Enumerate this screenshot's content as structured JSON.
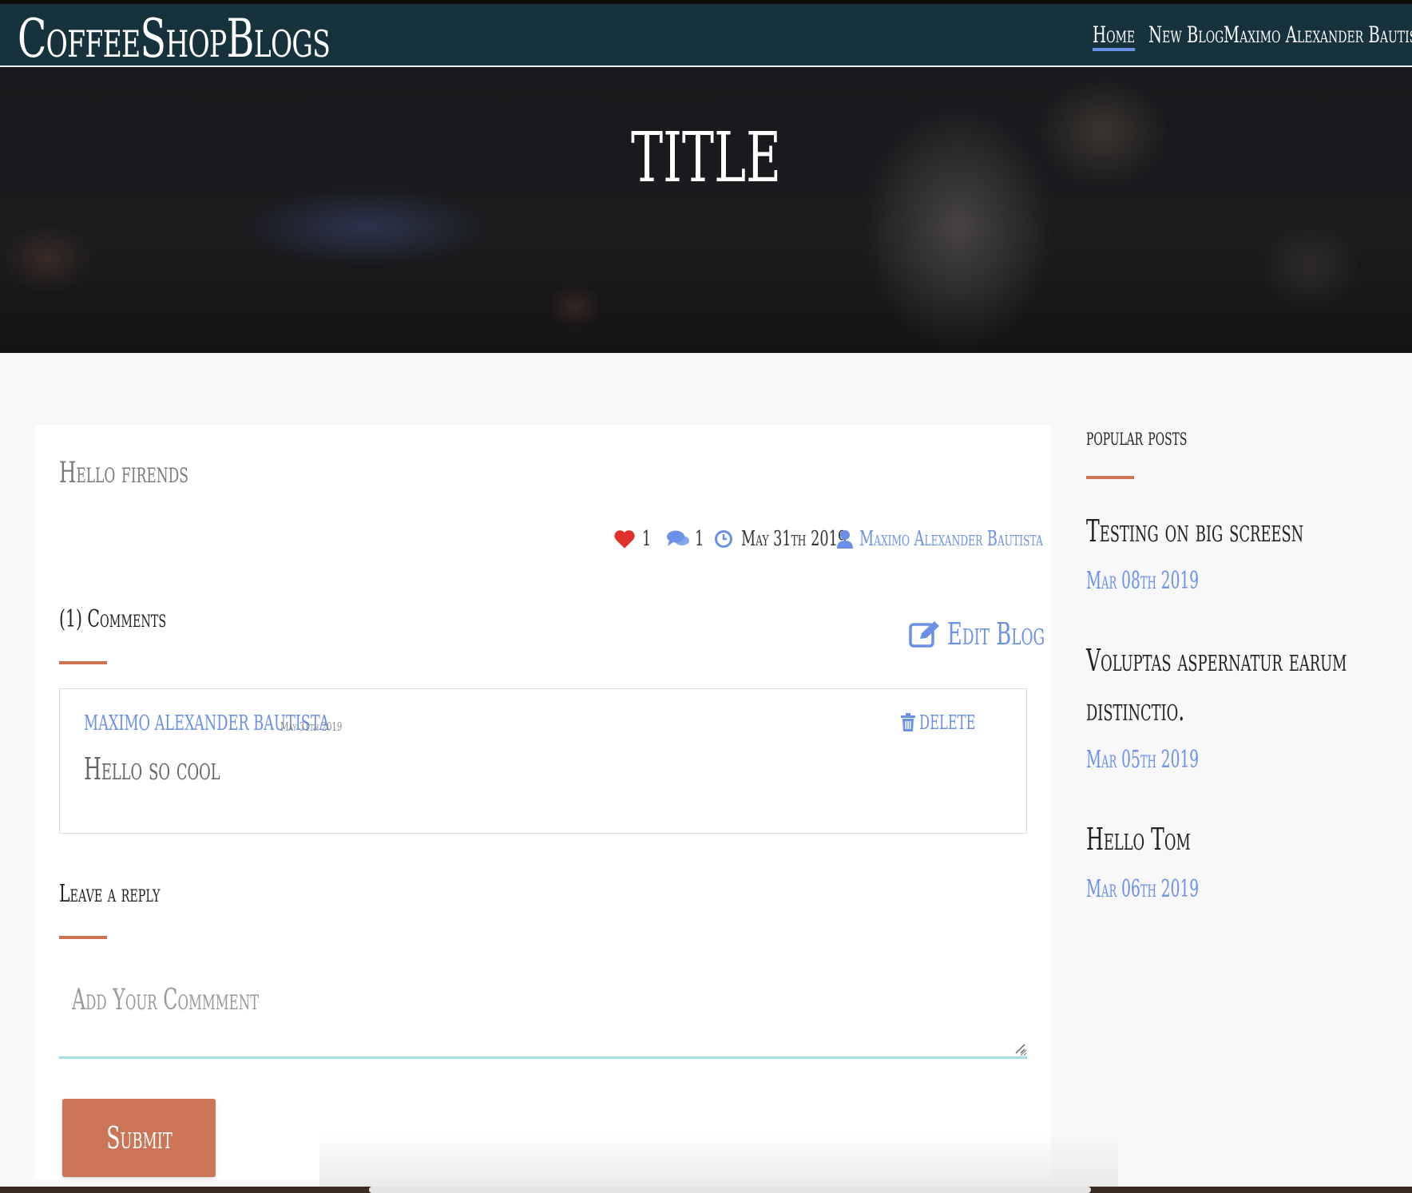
{
  "navbar": {
    "brand": "CoffeeShopBlogs",
    "links": {
      "home": "Home",
      "new_blog": "New Blog",
      "user": "Maximo Alexander Bautista"
    }
  },
  "hero": {
    "title": "TITLE"
  },
  "post": {
    "title": "Hello firends",
    "likes": "1",
    "comments_count": "1",
    "date": "May 31th 2019",
    "author": "Maximo Alexander Bautista"
  },
  "comments_section": {
    "heading": "(1) Comments",
    "edit_label": "Edit Blog",
    "items": [
      {
        "author": "MAXIMO ALEXANDER BAUTISTA",
        "date": "May 31th 2019",
        "body": "Hello so cool",
        "delete_label": "DELETE"
      }
    ]
  },
  "reply": {
    "heading": "Leave a reply",
    "placeholder": "Add Your Commment",
    "submit_label": "Submit"
  },
  "sidebar": {
    "title": "popular posts",
    "posts": [
      {
        "title": "Testing on big screesn",
        "date": "Mar 08th 2019"
      },
      {
        "title": "Voluptas aspernatur earum distinctio.",
        "date": "Mar 05th 2019"
      },
      {
        "title": "Hello Tom",
        "date": "Mar 06th 2019"
      }
    ]
  },
  "colors": {
    "navbar_bg": "#16323d",
    "accent": "#cb7556",
    "link": "#6a90e8",
    "heart": "#e0302a",
    "input_underline": "#a6dde2"
  },
  "icons": {
    "like": "heart-icon",
    "comments": "comments-icon",
    "date": "clock-icon",
    "author": "user-icon",
    "edit": "edit-icon",
    "delete": "trash-icon",
    "dropdown": "chevron-down-icon"
  }
}
